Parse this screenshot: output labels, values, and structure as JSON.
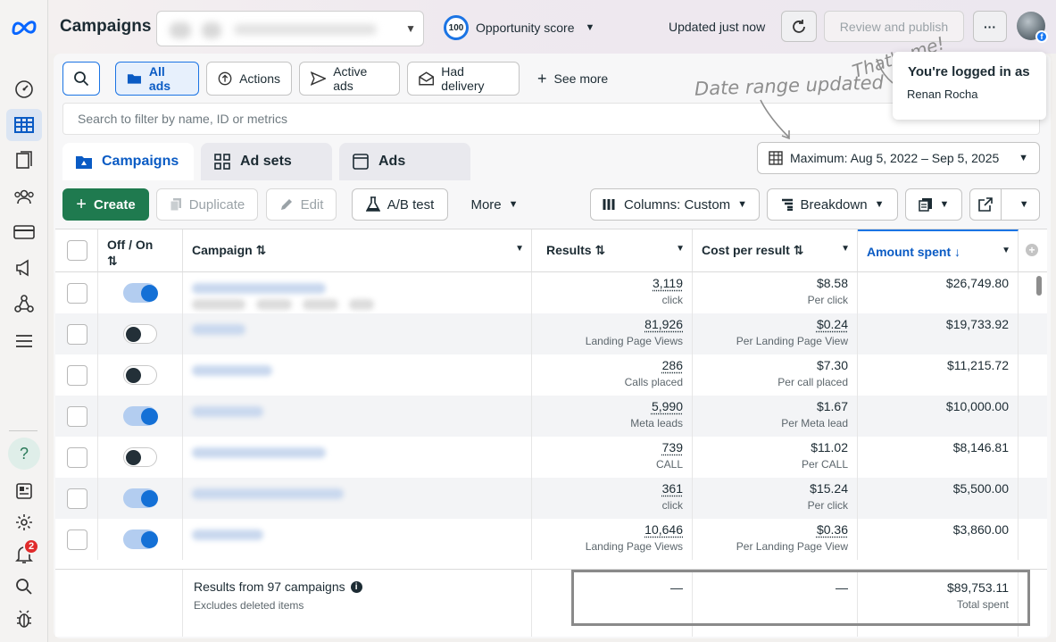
{
  "header": {
    "title": "Campaigns",
    "opportunity_score": "100",
    "opportunity_label": "Opportunity score",
    "updated": "Updated just now",
    "review_label": "Review and publish",
    "more_label": "···"
  },
  "popover": {
    "heading": "You're logged in as",
    "name": "Renan Rocha"
  },
  "annotations": {
    "thats_me": "That's me!",
    "date_range": "Date range updated"
  },
  "filters": {
    "all_ads": "All ads",
    "actions": "Actions",
    "active_ads": "Active ads",
    "had_delivery": "Had delivery",
    "see_more": "See more",
    "search_placeholder": "Search to filter by name, ID or metrics"
  },
  "tabs": [
    "Campaigns",
    "Ad sets",
    "Ads"
  ],
  "date_range": "Maximum: Aug 5, 2022 – Sep 5, 2025",
  "toolbar": {
    "create": "Create",
    "duplicate": "Duplicate",
    "edit": "Edit",
    "ab_test": "A/B test",
    "more": "More",
    "columns": "Columns: Custom",
    "breakdown": "Breakdown"
  },
  "columns": {
    "offon": "Off / On",
    "campaign": "Campaign",
    "results": "Results",
    "cpr": "Cost per result",
    "spent": "Amount spent"
  },
  "rows": [
    {
      "on": true,
      "results": "3,119",
      "result_type": "click",
      "cpr": "$8.58",
      "cpr_type": "Per click",
      "spent": "$26,749.80"
    },
    {
      "on": false,
      "results": "81,926",
      "result_type": "Landing Page Views",
      "cpr": "$0.24",
      "cpr_type": "Per Landing Page View",
      "spent": "$19,733.92"
    },
    {
      "on": false,
      "results": "286",
      "result_type": "Calls placed",
      "cpr": "$7.30",
      "cpr_type": "Per call placed",
      "spent": "$11,215.72"
    },
    {
      "on": true,
      "results": "5,990",
      "result_type": "Meta leads",
      "cpr": "$1.67",
      "cpr_type": "Per Meta lead",
      "spent": "$10,000.00"
    },
    {
      "on": false,
      "results": "739",
      "result_type": "CALL",
      "cpr": "$11.02",
      "cpr_type": "Per CALL",
      "spent": "$8,146.81"
    },
    {
      "on": true,
      "results": "361",
      "result_type": "click",
      "cpr": "$15.24",
      "cpr_type": "Per click",
      "spent": "$5,500.00"
    },
    {
      "on": true,
      "results": "10,646",
      "result_type": "Landing Page Views",
      "cpr": "$0.36",
      "cpr_type": "Per Landing Page View",
      "spent": "$3,860.00"
    }
  ],
  "footer": {
    "results_from": "Results from 97 campaigns",
    "excludes": "Excludes deleted items",
    "results_total": "—",
    "cpr_total": "—",
    "spent_total": "$89,753.11",
    "spent_label": "Total spent"
  },
  "nav": {
    "notification_count": "2"
  },
  "colors": {
    "accent": "#1b74e4",
    "create_green": "#1f7a4f"
  }
}
